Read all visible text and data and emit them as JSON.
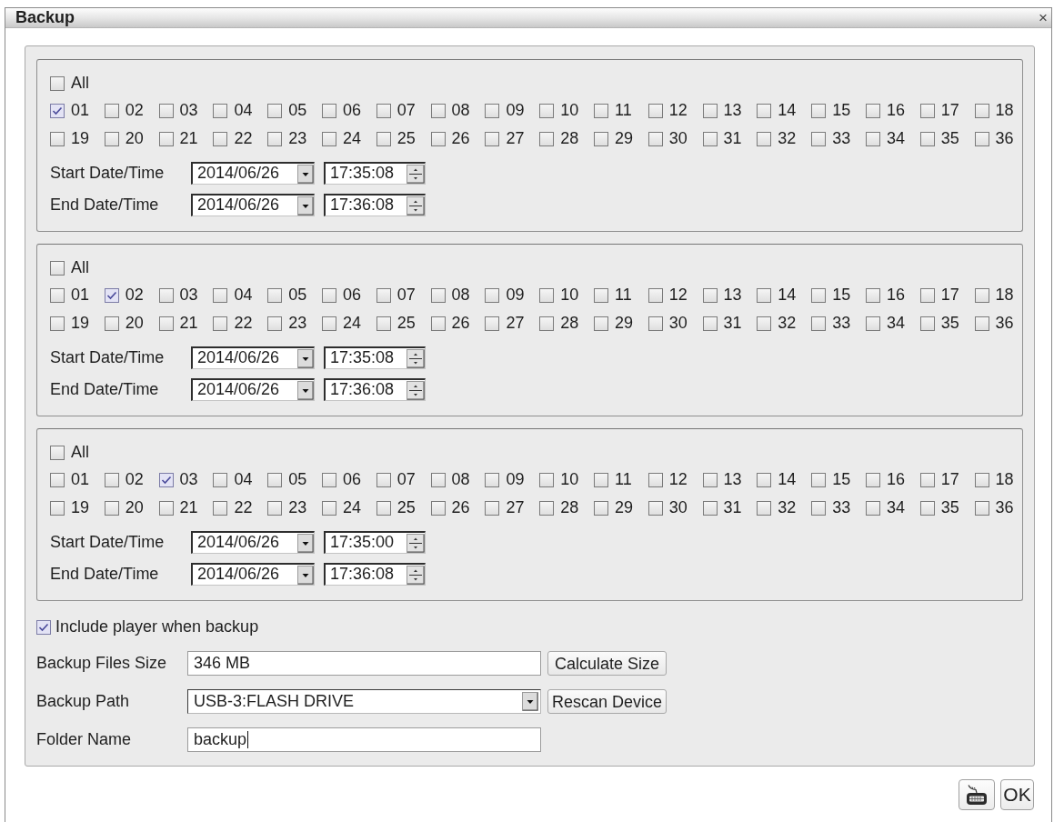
{
  "window": {
    "title": "Backup",
    "close": "×"
  },
  "groups": [
    {
      "all": {
        "label": "All",
        "checked": false
      },
      "channels": [
        {
          "label": "01",
          "checked": true
        },
        {
          "label": "02",
          "checked": false
        },
        {
          "label": "03",
          "checked": false
        },
        {
          "label": "04",
          "checked": false
        },
        {
          "label": "05",
          "checked": false
        },
        {
          "label": "06",
          "checked": false
        },
        {
          "label": "07",
          "checked": false
        },
        {
          "label": "08",
          "checked": false
        },
        {
          "label": "09",
          "checked": false
        },
        {
          "label": "10",
          "checked": false
        },
        {
          "label": "11",
          "checked": false
        },
        {
          "label": "12",
          "checked": false
        },
        {
          "label": "13",
          "checked": false
        },
        {
          "label": "14",
          "checked": false
        },
        {
          "label": "15",
          "checked": false
        },
        {
          "label": "16",
          "checked": false
        },
        {
          "label": "17",
          "checked": false
        },
        {
          "label": "18",
          "checked": false
        },
        {
          "label": "19",
          "checked": false
        },
        {
          "label": "20",
          "checked": false
        },
        {
          "label": "21",
          "checked": false
        },
        {
          "label": "22",
          "checked": false
        },
        {
          "label": "23",
          "checked": false
        },
        {
          "label": "24",
          "checked": false
        },
        {
          "label": "25",
          "checked": false
        },
        {
          "label": "26",
          "checked": false
        },
        {
          "label": "27",
          "checked": false
        },
        {
          "label": "28",
          "checked": false
        },
        {
          "label": "29",
          "checked": false
        },
        {
          "label": "30",
          "checked": false
        },
        {
          "label": "31",
          "checked": false
        },
        {
          "label": "32",
          "checked": false
        },
        {
          "label": "33",
          "checked": false
        },
        {
          "label": "34",
          "checked": false
        },
        {
          "label": "35",
          "checked": false
        },
        {
          "label": "36",
          "checked": false
        }
      ],
      "start": {
        "label": "Start Date/Time",
        "date": "2014/06/26",
        "time": "17:35:08"
      },
      "end": {
        "label": "End Date/Time",
        "date": "2014/06/26",
        "time": "17:36:08"
      }
    },
    {
      "all": {
        "label": "All",
        "checked": false
      },
      "channels": [
        {
          "label": "01",
          "checked": false
        },
        {
          "label": "02",
          "checked": true
        },
        {
          "label": "03",
          "checked": false
        },
        {
          "label": "04",
          "checked": false
        },
        {
          "label": "05",
          "checked": false
        },
        {
          "label": "06",
          "checked": false
        },
        {
          "label": "07",
          "checked": false
        },
        {
          "label": "08",
          "checked": false
        },
        {
          "label": "09",
          "checked": false
        },
        {
          "label": "10",
          "checked": false
        },
        {
          "label": "11",
          "checked": false
        },
        {
          "label": "12",
          "checked": false
        },
        {
          "label": "13",
          "checked": false
        },
        {
          "label": "14",
          "checked": false
        },
        {
          "label": "15",
          "checked": false
        },
        {
          "label": "16",
          "checked": false
        },
        {
          "label": "17",
          "checked": false
        },
        {
          "label": "18",
          "checked": false
        },
        {
          "label": "19",
          "checked": false
        },
        {
          "label": "20",
          "checked": false
        },
        {
          "label": "21",
          "checked": false
        },
        {
          "label": "22",
          "checked": false
        },
        {
          "label": "23",
          "checked": false
        },
        {
          "label": "24",
          "checked": false
        },
        {
          "label": "25",
          "checked": false
        },
        {
          "label": "26",
          "checked": false
        },
        {
          "label": "27",
          "checked": false
        },
        {
          "label": "28",
          "checked": false
        },
        {
          "label": "29",
          "checked": false
        },
        {
          "label": "30",
          "checked": false
        },
        {
          "label": "31",
          "checked": false
        },
        {
          "label": "32",
          "checked": false
        },
        {
          "label": "33",
          "checked": false
        },
        {
          "label": "34",
          "checked": false
        },
        {
          "label": "35",
          "checked": false
        },
        {
          "label": "36",
          "checked": false
        }
      ],
      "start": {
        "label": "Start Date/Time",
        "date": "2014/06/26",
        "time": "17:35:08"
      },
      "end": {
        "label": "End Date/Time",
        "date": "2014/06/26",
        "time": "17:36:08"
      }
    },
    {
      "all": {
        "label": "All",
        "checked": false
      },
      "channels": [
        {
          "label": "01",
          "checked": false
        },
        {
          "label": "02",
          "checked": false
        },
        {
          "label": "03",
          "checked": true
        },
        {
          "label": "04",
          "checked": false
        },
        {
          "label": "05",
          "checked": false
        },
        {
          "label": "06",
          "checked": false
        },
        {
          "label": "07",
          "checked": false
        },
        {
          "label": "08",
          "checked": false
        },
        {
          "label": "09",
          "checked": false
        },
        {
          "label": "10",
          "checked": false
        },
        {
          "label": "11",
          "checked": false
        },
        {
          "label": "12",
          "checked": false
        },
        {
          "label": "13",
          "checked": false
        },
        {
          "label": "14",
          "checked": false
        },
        {
          "label": "15",
          "checked": false
        },
        {
          "label": "16",
          "checked": false
        },
        {
          "label": "17",
          "checked": false
        },
        {
          "label": "18",
          "checked": false
        },
        {
          "label": "19",
          "checked": false
        },
        {
          "label": "20",
          "checked": false
        },
        {
          "label": "21",
          "checked": false
        },
        {
          "label": "22",
          "checked": false
        },
        {
          "label": "23",
          "checked": false
        },
        {
          "label": "24",
          "checked": false
        },
        {
          "label": "25",
          "checked": false
        },
        {
          "label": "26",
          "checked": false
        },
        {
          "label": "27",
          "checked": false
        },
        {
          "label": "28",
          "checked": false
        },
        {
          "label": "29",
          "checked": false
        },
        {
          "label": "30",
          "checked": false
        },
        {
          "label": "31",
          "checked": false
        },
        {
          "label": "32",
          "checked": false
        },
        {
          "label": "33",
          "checked": false
        },
        {
          "label": "34",
          "checked": false
        },
        {
          "label": "35",
          "checked": false
        },
        {
          "label": "36",
          "checked": false
        }
      ],
      "start": {
        "label": "Start Date/Time",
        "date": "2014/06/26",
        "time": "17:35:00"
      },
      "end": {
        "label": "End Date/Time",
        "date": "2014/06/26",
        "time": "17:36:08"
      }
    }
  ],
  "include_player": {
    "label": "Include player when backup",
    "checked": true
  },
  "fields": [
    {
      "kind": "text",
      "label": "Backup Files Size",
      "value": "346 MB",
      "button": "Calculate Size",
      "focused": false
    },
    {
      "kind": "dropdown",
      "label": "Backup Path",
      "value": "USB-3:FLASH DRIVE",
      "button": "Rescan Device",
      "focused": false
    },
    {
      "kind": "text",
      "label": "Folder Name",
      "value": "backup",
      "focused": true
    }
  ],
  "buttons": [
    {
      "kind": "keyboard"
    },
    {
      "kind": "text",
      "label": "OK"
    }
  ]
}
